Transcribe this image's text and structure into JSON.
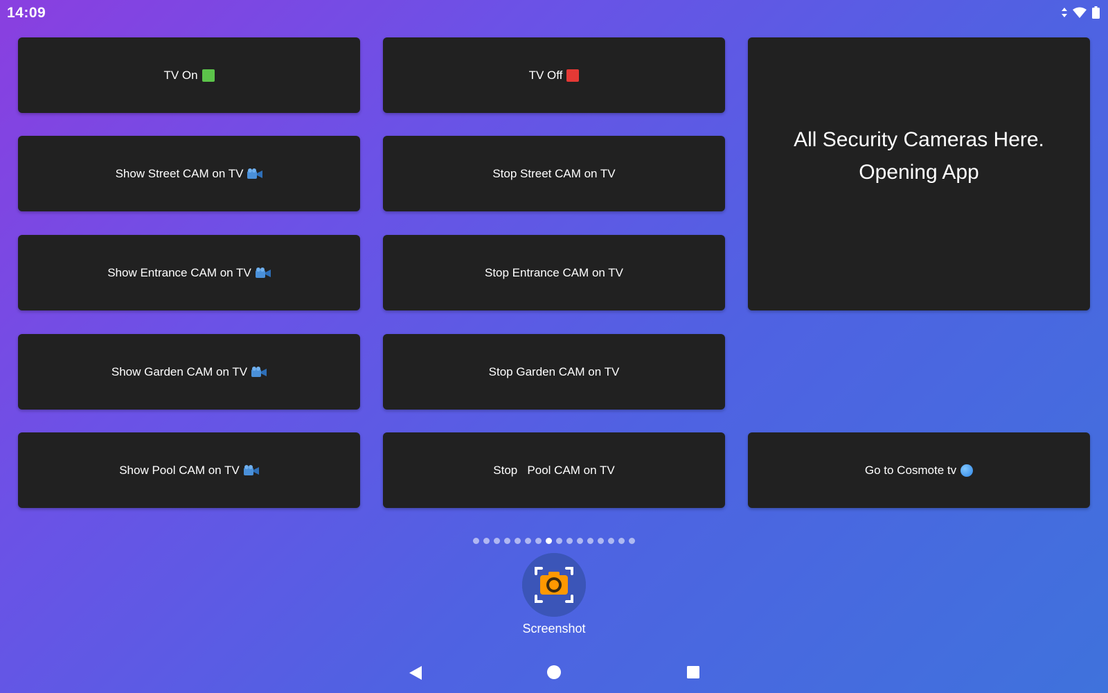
{
  "status": {
    "time": "14:09",
    "icons": [
      "data-arrows-icon",
      "wifi-icon",
      "battery-icon"
    ]
  },
  "tiles": {
    "tv_on": {
      "label": "TV On",
      "icon": "green-square-icon"
    },
    "tv_off": {
      "label": "TV Off",
      "icon": "red-square-icon"
    },
    "show_street": {
      "label": "Show Street CAM on TV",
      "icon": "video-camera-icon"
    },
    "stop_street": {
      "label": "Stop Street CAM on TV"
    },
    "show_entrance": {
      "label": "Show Entrance CAM on TV",
      "icon": "video-camera-icon"
    },
    "stop_entrance": {
      "label": "Stop Entrance CAM on TV"
    },
    "show_garden": {
      "label": "Show Garden CAM on TV",
      "icon": "video-camera-icon"
    },
    "stop_garden": {
      "label": "Stop Garden CAM on TV"
    },
    "show_pool": {
      "label": "Show Pool CAM on TV",
      "icon": "video-camera-icon"
    },
    "stop_pool": {
      "label": "Stop   Pool CAM on TV"
    },
    "security_app": {
      "line1": "All Security Cameras Here.",
      "line2": "Opening App"
    },
    "cosmote": {
      "label": "Go to Cosmote tv",
      "icon": "globe-icon"
    }
  },
  "page_indicator": {
    "total": 16,
    "current": 8
  },
  "dock": {
    "app_label": "Screenshot",
    "icon": "screenshot-camera-icon"
  },
  "navbar": {
    "buttons": [
      "back-button",
      "home-button",
      "recents-button"
    ]
  },
  "colors": {
    "tile": "#212121",
    "green": "#5cc44a",
    "red": "#e53935",
    "app_icon_bg": "#3b55b8",
    "app_icon_fg": "#ff9800"
  }
}
